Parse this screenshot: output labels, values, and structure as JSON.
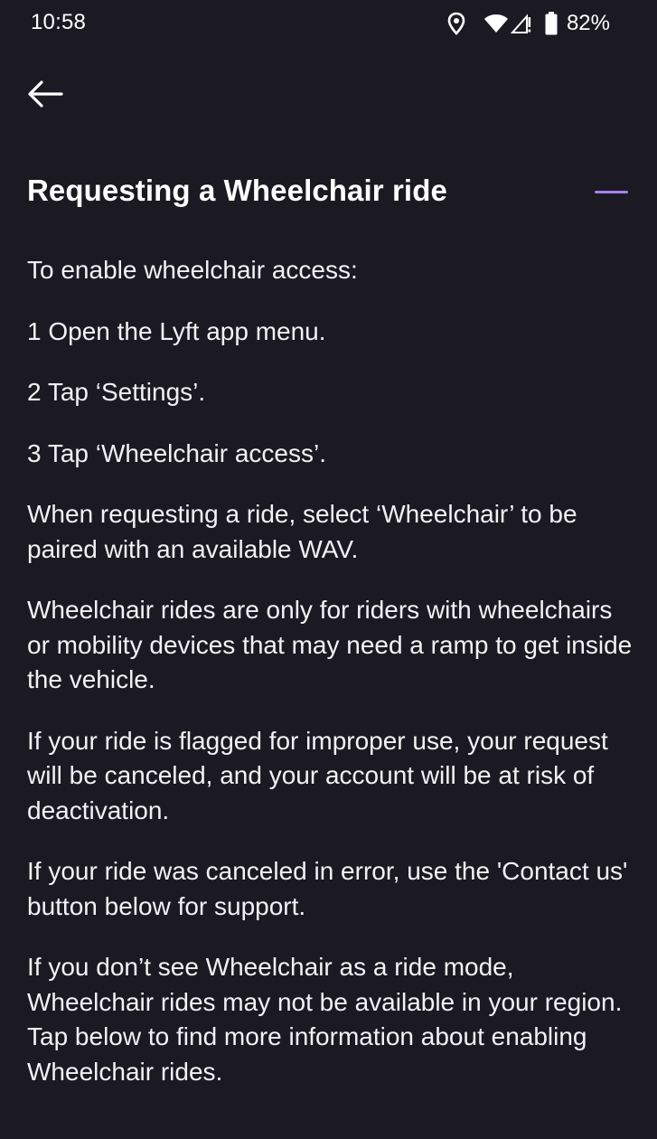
{
  "status_bar": {
    "time": "10:58",
    "battery_percent": "82%",
    "icons": [
      "location-icon",
      "wifi-icon",
      "cell-signal-icon",
      "battery-icon"
    ]
  },
  "nav": {
    "back_icon": "arrow-left-icon"
  },
  "section": {
    "title": "Requesting a Wheelchair ride",
    "collapse_icon": "minus-icon",
    "accent_color": "#a97ef0"
  },
  "content": {
    "intro": "To enable wheelchair access:",
    "steps": [
      "1  Open the Lyft app menu.",
      "2  Tap ‘Settings’.",
      "3  Tap ‘Wheelchair access’."
    ],
    "paragraphs": [
      "When requesting a ride, select ‘Wheelchair’ to be paired with an available WAV.",
      "Wheelchair rides are only for riders with wheelchairs or mobility devices that may need a ramp to get inside the vehicle.",
      "If your ride is flagged for improper use, your request will be canceled, and your account will be at risk of deactivation.",
      "If your ride was canceled in error, use the 'Contact us' button below for support.",
      "If you don’t see Wheelchair as a ride mode, Wheelchair rides may not be available in your region. Tap below to find more information about enabling Wheelchair rides."
    ]
  },
  "colors": {
    "background": "#1b1a22",
    "text": "#ffffff"
  }
}
